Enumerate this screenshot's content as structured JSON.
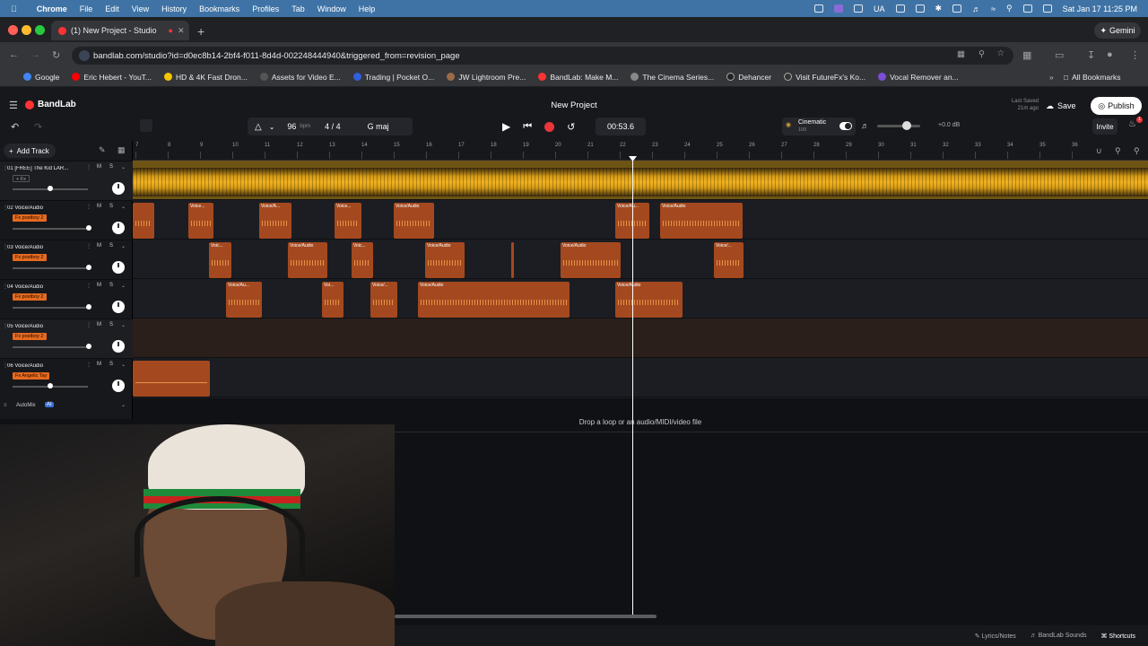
{
  "menubar": {
    "app": "Chrome",
    "items": [
      "File",
      "Edit",
      "View",
      "History",
      "Bookmarks",
      "Profiles",
      "Tab",
      "Window",
      "Help"
    ],
    "lang": "UA",
    "clock": "Sat Jan 17  11:25 PM"
  },
  "browser": {
    "tab_title": "(1) New Project - Studio",
    "url": "bandlab.com/studio?id=d0ec8b14-2bf4-f011-8d4d-002248444940&triggered_from=revision_page",
    "gemini": "Gemini",
    "bookmarks": [
      {
        "label": "Google",
        "color": "#4285f4"
      },
      {
        "label": "Eric Hebert - YouT...",
        "color": "#ff0000"
      },
      {
        "label": "HD & 4K Fast Dron...",
        "color": "#f7c600"
      },
      {
        "label": "Assets for Video E...",
        "color": "#555555"
      },
      {
        "label": "Trading | Pocket O...",
        "color": "#2f5fe0"
      },
      {
        "label": "JW Lightroom Pre...",
        "color": "#9b6b4a"
      },
      {
        "label": "BandLab: Make M...",
        "color": "#f33333"
      },
      {
        "label": "The Cinema Series...",
        "color": "#888888"
      },
      {
        "label": "Dehancer",
        "color": "#222222"
      },
      {
        "label": "Visit FutureFx's Ko...",
        "color": "#333333"
      },
      {
        "label": "Vocal Remover an...",
        "color": "#7b4fd6"
      }
    ],
    "all_bookmarks": "All Bookmarks"
  },
  "studio": {
    "logo": "BandLab",
    "project_title": "New Project",
    "last_saved_label": "Last Saved",
    "last_saved_time": "21m ago",
    "save": "Save",
    "publish": "Publish",
    "tempo": "96",
    "tempo_unit": "bpm",
    "time_signature": "4 / 4",
    "key": "G maj",
    "time": "00:53.6",
    "preset": "Cinematic",
    "preset_value": "100",
    "master_db": "+0.0 dB",
    "invite": "Invite",
    "notification_count": "1",
    "add_track": "Add Track",
    "automix": "AutoMix",
    "automix_badge": "AI",
    "drop_hint": "Drop a loop or an audio/MIDI/video file",
    "footer": {
      "lyrics": "Lyrics/Notes",
      "sounds": "BandLab Sounds",
      "shortcuts": "Shortcuts"
    }
  },
  "ruler": [
    "7",
    "8",
    "9",
    "10",
    "11",
    "12",
    "13",
    "14",
    "15",
    "16",
    "17",
    "18",
    "19",
    "20",
    "21",
    "22",
    "23",
    "24",
    "25",
    "26",
    "27",
    "28",
    "29",
    "30",
    "31",
    "32",
    "33",
    "34",
    "35",
    "36"
  ],
  "tracks": [
    {
      "name": "01  [FREE] The Kid LAR...",
      "fx": "+ Fx",
      "m": "M",
      "s": "S"
    },
    {
      "name": "02  Voice/Audio",
      "fx": "Fx  postboy 2",
      "m": "M",
      "s": "S"
    },
    {
      "name": "03  Voice/Audio",
      "fx": "Fx  postboy 2",
      "m": "M",
      "s": "S"
    },
    {
      "name": "04  Voice/Audio",
      "fx": "Fx  postboy 2",
      "m": "M",
      "s": "S"
    },
    {
      "name": "05  Voice/Audio",
      "fx": "Fx  postboy 2",
      "m": "M",
      "s": "S"
    },
    {
      "name": "06  Voice/Audio",
      "fx": "Fx  Angelic Tay",
      "m": "M",
      "s": "S"
    }
  ],
  "clip_labels": {
    "t2": [
      "",
      "Voice...",
      "Voice/A...",
      "Voice...",
      "Voice/Audio",
      "Voice/Au...",
      "Voice/Audio"
    ],
    "t3": [
      "Voic...",
      "Voice/Audio",
      "Voic...",
      "Voice/Audio",
      "",
      "Voice/Audio",
      "Voice/..."
    ],
    "t4": [
      "Voice/Au...",
      "Voi...",
      "Voice/...",
      "Voice/Audio",
      "Voice/Audio"
    ]
  },
  "colors": {
    "accent": "#e66a1f",
    "beat": "#f2b321",
    "record": "#e8363a",
    "clip": "#a4491f"
  }
}
